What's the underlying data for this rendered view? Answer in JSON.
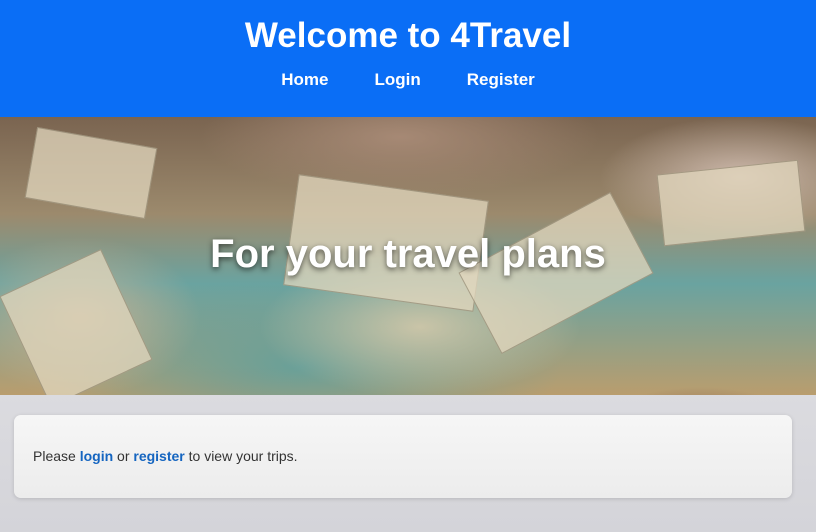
{
  "header": {
    "title": "Welcome to 4Travel",
    "nav": [
      {
        "label": "Home"
      },
      {
        "label": "Login"
      },
      {
        "label": "Register"
      }
    ]
  },
  "hero": {
    "headline": "For your travel plans"
  },
  "message": {
    "prefix": "Please",
    "login_link": "login",
    "middle": "or",
    "register_link": "register",
    "suffix": "to view your trips."
  },
  "colors": {
    "brand": "#0a6ef6",
    "link": "#1565c0"
  }
}
